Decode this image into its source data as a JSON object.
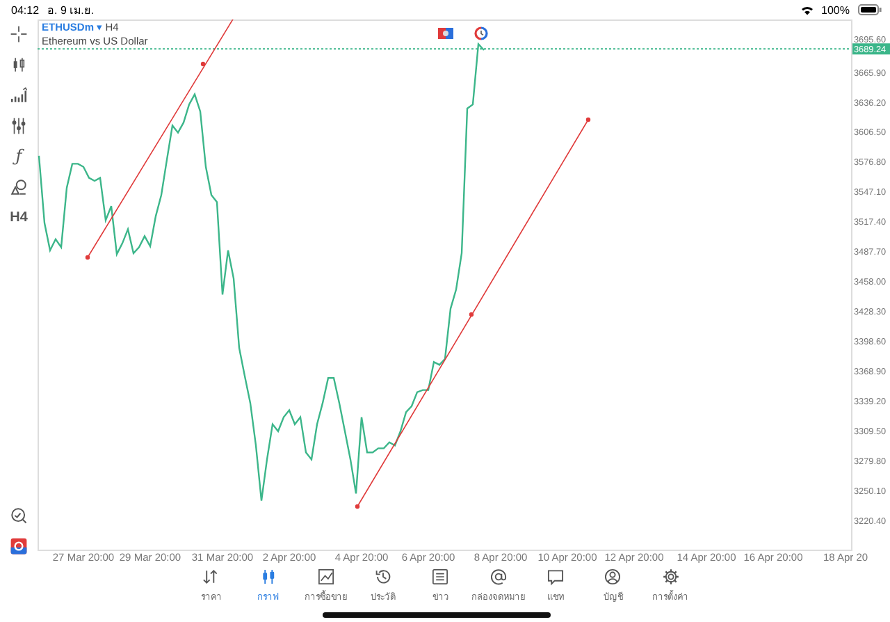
{
  "status_bar": {
    "time": "04:12",
    "date": "อ. 9 เม.ย.",
    "battery": "100%"
  },
  "toolbar": [
    {
      "kind": "crosshair"
    },
    {
      "kind": "candles"
    },
    {
      "kind": "bars"
    },
    {
      "kind": "sliders"
    },
    {
      "kind": "text",
      "label": "ƒ"
    },
    {
      "kind": "shapes"
    },
    {
      "kind": "text",
      "label": "H4"
    },
    {
      "kind": "spacer"
    },
    {
      "kind": "search-chart"
    },
    {
      "kind": "logo"
    }
  ],
  "symbol": {
    "name": "ETHUSDm",
    "caret": "▾",
    "timeframe": "H4",
    "description": "Ethereum vs US Dollar"
  },
  "chart_data": {
    "type": "line",
    "ylim": [
      3191.3,
      3718.5
    ],
    "categories": [
      null,
      null,
      null,
      null,
      null,
      null,
      null,
      null,
      "27 Mar 20:00",
      null,
      null,
      null,
      null,
      null,
      null,
      null,
      null,
      null,
      null,
      null,
      "29 Mar 20:00",
      null,
      null,
      null,
      null,
      null,
      null,
      null,
      null,
      null,
      null,
      null,
      null,
      "31 Mar 20:00",
      null,
      null,
      null,
      null,
      null,
      null,
      null,
      null,
      null,
      null,
      null,
      "2 Apr 20:00",
      null,
      null,
      null,
      null,
      null,
      null,
      null,
      null,
      null,
      null,
      null,
      null,
      "4 Apr 20:00",
      null,
      null,
      null,
      null,
      null,
      null,
      null,
      null,
      null,
      null,
      null,
      "6 Apr 20:00",
      null,
      null,
      null,
      null,
      null,
      null,
      null,
      null,
      null,
      null,
      null,
      null,
      "8 Apr 20:00",
      null,
      null,
      null,
      null,
      null,
      null,
      null,
      null,
      null,
      null,
      null,
      "10 Apr 20:00",
      null,
      null,
      null,
      null,
      null,
      null,
      null,
      null,
      null,
      null,
      null,
      "12 Apr 20:00",
      null,
      null,
      null,
      null,
      null,
      null,
      null,
      null,
      null,
      null,
      null,
      null,
      "14 Apr 20:00",
      null,
      null,
      null,
      null,
      null,
      null,
      null,
      null,
      null,
      null,
      null,
      "16 Apr 20:00",
      null,
      null,
      null,
      null,
      null,
      null,
      null,
      null,
      null,
      null,
      null,
      null,
      "18 Apr 20"
    ],
    "series": [
      {
        "color": "#3cb68a",
        "values": [
          3583,
          3516,
          3489,
          3500,
          3492,
          3551,
          3575,
          3575,
          3572,
          3561,
          3558,
          3561,
          3519,
          3533,
          3485,
          3496,
          3510,
          3486,
          3492,
          3503,
          3493,
          3523,
          3544,
          3579,
          3613,
          3606,
          3616,
          3634,
          3644,
          3627,
          3572,
          3544,
          3537,
          3445,
          3489,
          3461,
          3392,
          3364,
          3337,
          3295,
          3240,
          3281,
          3316,
          3309,
          3323,
          3330,
          3316,
          3323,
          3288,
          3281,
          3316,
          3337,
          3362,
          3362,
          3337,
          3309,
          3281,
          3247,
          3323,
          3288,
          3288,
          3292,
          3292,
          3298,
          3295,
          3309,
          3328,
          3334,
          3348,
          3350,
          3350,
          3378,
          3375,
          3381,
          3431,
          3450,
          3486,
          3630,
          3634,
          3694,
          3688,
          null,
          null,
          null,
          null,
          null,
          null,
          null,
          null,
          null,
          null,
          null,
          null,
          null,
          null,
          null,
          null,
          null,
          null,
          null,
          null,
          null,
          null,
          null,
          null,
          null,
          null,
          null,
          null,
          null,
          null,
          null,
          null,
          null,
          null,
          null,
          null,
          null,
          null,
          null,
          null,
          null,
          null,
          null,
          null,
          null,
          null,
          null,
          null,
          null,
          null,
          null,
          null,
          null,
          null,
          null,
          null,
          null,
          null,
          null,
          null,
          null,
          null,
          null,
          null,
          null
        ]
      }
    ],
    "yticks": [
      {
        "value": 3695.6,
        "label": "3695.60"
      },
      {
        "value": 3665.9,
        "label": "3665.90"
      },
      {
        "value": 3636.2,
        "label": "3636.20"
      },
      {
        "value": 3606.5,
        "label": "3606.50"
      },
      {
        "value": 3576.8,
        "label": "3576.80"
      },
      {
        "value": 3547.1,
        "label": "3547.10"
      },
      {
        "value": 3517.4,
        "label": "3517.40"
      },
      {
        "value": 3487.7,
        "label": "3487.70"
      },
      {
        "value": 3458.0,
        "label": "3458.00"
      },
      {
        "value": 3428.3,
        "label": "3428.30"
      },
      {
        "value": 3398.6,
        "label": "3398.60"
      },
      {
        "value": 3368.9,
        "label": "3368.90"
      },
      {
        "value": 3339.2,
        "label": "3339.20"
      },
      {
        "value": 3309.5,
        "label": "3309.50"
      },
      {
        "value": 3279.8,
        "label": "3279.80"
      },
      {
        "value": 3250.1,
        "label": "3250.10"
      },
      {
        "value": 3220.4,
        "label": "3220.40"
      }
    ],
    "ref_lines": [
      {
        "axis": "y",
        "value": 3689.24,
        "label": "3689.24"
      }
    ]
  },
  "tabs": [
    {
      "kind": "price",
      "label": "ราคา",
      "selected": false
    },
    {
      "kind": "chart",
      "label": "กราฟ",
      "selected": true
    },
    {
      "kind": "trade",
      "label": "การซื้อขาย",
      "selected": false
    },
    {
      "kind": "history",
      "label": "ประวัติ",
      "selected": false
    },
    {
      "kind": "news",
      "label": "ข่าว",
      "selected": false
    },
    {
      "kind": "mail",
      "label": "กล่องจดหมาย",
      "selected": false
    },
    {
      "kind": "chat",
      "label": "แชท",
      "selected": false
    },
    {
      "kind": "account",
      "label": "บัญชี",
      "selected": false
    },
    {
      "kind": "settings",
      "label": "การตั้งค่า",
      "selected": false
    }
  ]
}
